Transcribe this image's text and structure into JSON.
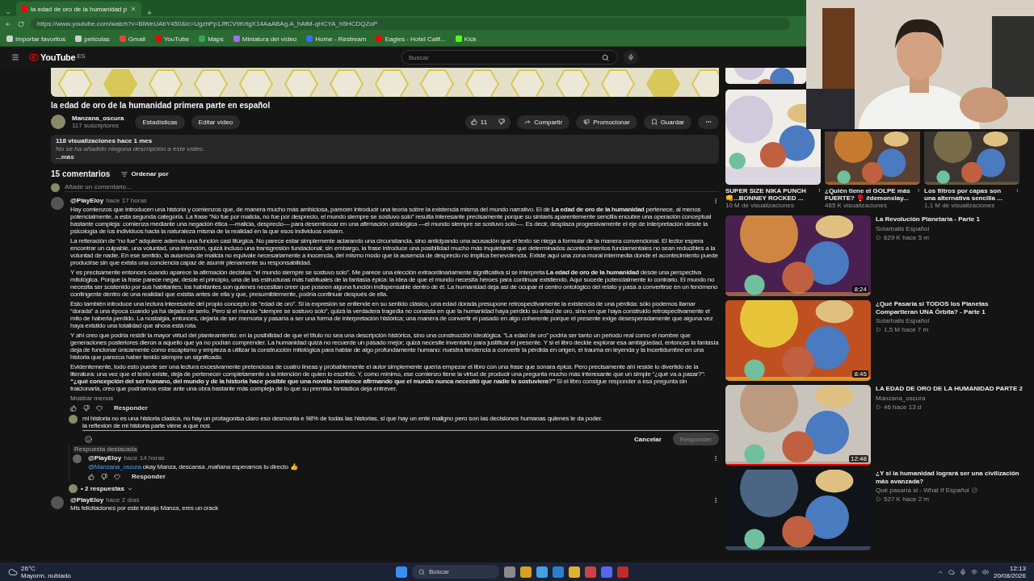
{
  "browser": {
    "tabs": [
      {
        "title": "la edad de oro de la humanidad p",
        "selected": true
      }
    ],
    "url": "https://www.youtube.com/watch?v=BlWeUAbY450&lc=UgzhPp1JffCV9KrtgX14AaABAg.A_hAtM-qHCYA_h5HCDQZoP",
    "bookmarks": [
      {
        "label": "Importar favoritos",
        "color": "#d0d0d0"
      },
      {
        "label": "películas",
        "color": "#d0d0d0"
      },
      {
        "label": "Gmail",
        "color": "#ea4335"
      },
      {
        "label": "YouTube",
        "color": "#ff0000"
      },
      {
        "label": "Maps",
        "color": "#34a853"
      },
      {
        "label": "Miniatura del vídeo",
        "color": "#a56cf0"
      },
      {
        "label": "Home - Restream",
        "color": "#3b6bf0"
      },
      {
        "label": "Eagles - Hotel Calif...",
        "color": "#ff0000"
      },
      {
        "label": "Kick",
        "color": "#53fc18"
      }
    ]
  },
  "youtube": {
    "logo": "YouTube",
    "region": "ES",
    "search_placeholder": "Buscar"
  },
  "video": {
    "title": "la edad de oro de la humanidad primera parte en español",
    "channel": "Manzana_oscura",
    "subscribers": "117 suscriptores",
    "owner_buttons": [
      "Estadísticas",
      "Editar vídeo"
    ],
    "likes": "11",
    "actions": [
      {
        "kind": "share",
        "label": "Compartir"
      },
      {
        "kind": "promote",
        "label": "Promocionar"
      },
      {
        "kind": "save",
        "label": "Guardar"
      }
    ],
    "description": {
      "meta": "118 visualizaciones  hace 1 mes",
      "text": "No se ha añadido ninguna descripción a este vídeo.",
      "more": "...más"
    }
  },
  "comments": {
    "count": "15 comentarios",
    "sort": "Ordenar por",
    "add_placeholder": "Añade un comentario...",
    "main_comment": {
      "author": "@PlayEloy",
      "time": "hace 17 horas",
      "collapse": "Mostrar menos",
      "reply": "Responder",
      "paragraphs": [
        "Hay comienzos que introducen una historia y comienzos que, de manera mucho más ambiciosa, parecen introducir una teoría sobre la existencia misma del mundo narrativo. El de **La edad de oro de la humanidad** pertenece, al menos potencialmente, a esta segunda categoría. La frase “No fue por malicia, no fue por desprecio, el mundo siempre se sostuvo solo” resulta interesante precisamente porque su sintaxis aparentemente sencilla encubre una operación conceptual bastante compleja: comienza mediante una negación ética —malicia, desprecio— para desembocar en una afirmación ontológica —el mundo siempre se sostuvo solo—. Es decir, desplaza progresivamente el eje de interpretación desde la psicología de los individuos hacia la naturaleza misma de la realidad en la que esos individuos existen.",
        "La reiteración de “no fue” adquiere además una función casi litúrgica. No parece estar simplemente aclarando una circunstancia, sino anticipando una acusación que el texto se niega a formular de la manera convencional. El lector espera encontrar un culpable, una voluntad, una intención, quizá incluso una transgresión fundacional; sin embargo, la frase introduce una posibilidad mucho más inquietante: que determinados acontecimientos fundamentales no sean reducibles a la voluntad de nadie. En ese sentido, la ausencia de malicia no equivale necesariamente a inocencia, del mismo modo que la ausencia de desprecio no implica benevolencia. Existe aquí una zona moral intermedia donde el acontecimiento puede producirse sin que exista una conciencia capaz de asumir plenamente su responsabilidad.",
        "Y es precisamente entonces cuando aparece la afirmación decisiva: “el mundo siempre se sostuvo solo”. Me parece una elección extraordinariamente significativa si se interpreta **La edad de oro de la humanidad** desde una perspectiva mitológica. Porque la frase parece negar, desde el principio, una de las estructuras más habituales de la fantasía épica: la idea de que el mundo necesita héroes para continuar existiendo. Aquí sucede potencialmente lo contrario. El mundo no necesita ser sostenido por sus habitantes; los habitantes son quienes necesitan creer que poseen alguna función indispensable dentro de él. La humanidad deja así de ocupar el centro ontológico del relato y pasa a convertirse en un fenómeno contingente dentro de una realidad que existía antes de ella y que, presumiblemente, podría continuar después de ella.",
        "Esto también introduce una lectura interesante del propio concepto de “edad de oro”. Si la expresión se entiende en su sentido clásico, una edad dorada presupone retrospectivamente la existencia de una pérdida: sólo podemos llamar “dorada” a una época cuando ya ha dejado de serlo. Pero si el mundo “siempre se sostuvo solo”, quizá la verdadera tragedia no consista en que la humanidad haya perdido su edad de oro, sino en que haya construido retrospectivamente el mito de haberla perdido. La nostalgia, entonces, dejaría de ser memoria y pasaría a ser una forma de interpretación histórica; una manera de convertir el pasado en algo coherente porque el presente exige desesperadamente que alguna vez haya existido una totalidad que ahora está rota.",
        "Y ahí creo que podría residir la mayor virtud del planteamiento: en la posibilidad de que el título no sea una descripción histórica, sino una construcción ideológica. “La edad de oro” podría ser tanto un periodo real como el nombre que generaciones posteriores dieron a aquello que ya no podían comprender. La humanidad quizá no recuerde un pasado mejor; quizá necesite inventarlo para justificar el presente. Y si el libro decide explorar esa ambigüedad, entonces la fantasía deja de funcionar únicamente como escapismo y empieza a utilizar la construcción mitológica para hablar de algo profundamente humano: nuestra tendencia a convertir la pérdida en origen, el trauma en leyenda y la incertidumbre en una historia que parezca haber tenido siempre un significado.",
        "Evidentemente, todo esto puede ser una lectura excesivamente pretenciosa de cuatro líneas y probablemente el autor simplemente quería empezar el libro con una frase que sonara épica. Pero precisamente ahí reside lo divertido de la literatura: una vez que el texto existe, deja de pertenecer completamente a la intención de quien lo escribió. Y, como mínimo, ese comienzo tiene la virtud de producir una pregunta mucho más interesante que un simple “¿qué va a pasar?”: **“¿qué concepción del ser humano, del mundo y de la historia hace posible que una novela comience afirmando que el mundo nunca necesitó que nadie lo sostuviera?”** Si el libro consigue responder a esa pregunta sin traicionarla, creo que podríamos estar ante una obra bastante más compleja de lo que su premisa fantástica deja entrever."
      ]
    },
    "reply_box": {
      "value": "mi historia no es una historia clasica, no hay un protagonisa claro eso desmonta e 98% de todas las historias, si que hay un ente maligno pero son las decisiones humanas quienes le da poder.\nla reflexion de mi historia parte viene a que nos ",
      "cancel": "Cancelar",
      "submit": "Responder"
    },
    "highlight_label": "Respuesta destacada",
    "pinned_reply": {
      "author": "@PlayEloy",
      "time": "hace 14 horas",
      "mention": "@Manzana_oscura",
      "text": "okay Manza, descansa ,mañana esperamos tu directo 👍",
      "reply": "Responder"
    },
    "replies_toggle": "• 2 respuestas",
    "next_comment": {
      "author": "@PlayEloy",
      "time": "hace 2 días",
      "text": "Mis felicitaciones por este trabajo Manza, eres un crack"
    }
  },
  "sidebar": {
    "shorts": [
      {
        "title": "SUPER SIZE NIKA PUNCH 👊...BONNEY ROCKED ...",
        "views": "10 M de visualizaciones"
      },
      {
        "title": "¿Quién tiene el GOLPE más FUERTE? 🥊 #demonslay...",
        "views": "465 K visualizaciones"
      },
      {
        "title": "Los filtros por capas son una alternativa sencilla ...",
        "views": "1,1 M de visualizaciones"
      }
    ],
    "videos": [
      {
        "title": "La Revolución Planetaria - Parte 1",
        "channel": "Solarballs Español",
        "meta": "629 K  hace 5 m",
        "duration": "8:24",
        "verified": false
      },
      {
        "title": "¿Qué Pasaría si TODOS los Planetas Compartieran UNA Órbita? - Parte 1",
        "channel": "Solarballs Español",
        "meta": "1,5 M  hace 7 m",
        "duration": "8:45",
        "verified": false
      },
      {
        "title": "LA EDAD DE ORO DE LA HUMANIDAD PARTE 2",
        "channel": "Manzana_oscura",
        "meta": "46  hace 13 d",
        "duration": "12:48",
        "level": 1,
        "verified": false
      },
      {
        "title": "¿Y si la humanidad logrará ser una civilización más avanzada?",
        "channel": "Qué pasaría si - What If Español",
        "meta": "527 K  hace 2 m",
        "verified": true
      }
    ]
  },
  "taskbar": {
    "temperature": "26°C",
    "weather": "Mayorm. nublado",
    "search_placeholder": "Buscar",
    "time": "12:13",
    "date": "20/08/2026"
  }
}
